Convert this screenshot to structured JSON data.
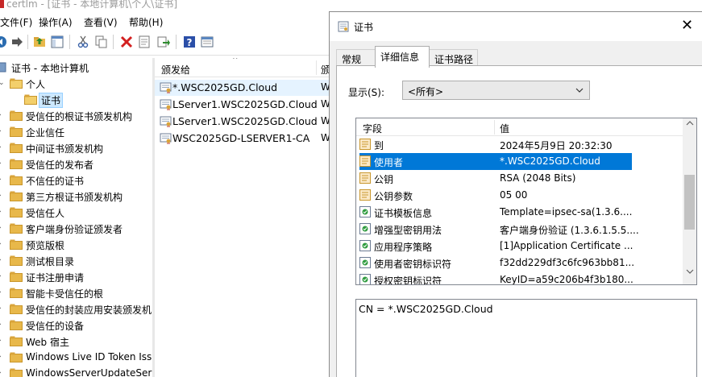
{
  "window": {
    "title": "certlm - [证书 - 本地计算机\\个人\\证书]"
  },
  "menu": [
    "文件(F)",
    "操作(A)",
    "查看(V)",
    "帮助(H)"
  ],
  "toolbar": [
    "back-icon",
    "forward-icon",
    "up-folder-icon",
    "show-hide-tree-icon",
    "cut-icon",
    "copy-icon",
    "delete-icon",
    "properties-icon",
    "export-icon",
    "help-icon",
    "view-icon"
  ],
  "tree": {
    "root": "证书 - 本地计算机",
    "items": [
      {
        "label": "个人",
        "level": 1,
        "expanded": true
      },
      {
        "label": "证书",
        "level": 2,
        "selected": true
      },
      {
        "label": "受信任的根证书颁发机构",
        "level": 1
      },
      {
        "label": "企业信任",
        "level": 1
      },
      {
        "label": "中间证书颁发机构",
        "level": 1
      },
      {
        "label": "受信任的发布者",
        "level": 1
      },
      {
        "label": "不信任的证书",
        "level": 1
      },
      {
        "label": "第三方根证书颁发机构",
        "level": 1
      },
      {
        "label": "受信任人",
        "level": 1
      },
      {
        "label": "客户端身份验证颁发者",
        "level": 1
      },
      {
        "label": "预览版根",
        "level": 1
      },
      {
        "label": "测试根目录",
        "level": 1
      },
      {
        "label": "证书注册申请",
        "level": 1
      },
      {
        "label": "智能卡受信任的根",
        "level": 1
      },
      {
        "label": "受信任的封装应用安装颁发机",
        "level": 1
      },
      {
        "label": "受信任的设备",
        "level": 1
      },
      {
        "label": "Web 宿主",
        "level": 1
      },
      {
        "label": "Windows Live ID Token Iss",
        "level": 1
      },
      {
        "label": "WindowsServerUpdateSer",
        "level": 1
      }
    ]
  },
  "list": {
    "col_issued_to": "颁发给",
    "col_issued_by": "颁",
    "rows": [
      {
        "name": "*.WSC2025GD.Cloud",
        "by": "W",
        "selected": true
      },
      {
        "name": "LServer1.WSC2025GD.Cloud",
        "by": "W"
      },
      {
        "name": "LServer1.WSC2025GD.Cloud",
        "by": "W"
      },
      {
        "name": "WSC2025GD-LSERVER1-CA",
        "by": "W"
      }
    ]
  },
  "dialog": {
    "title": "证书",
    "close": "✕",
    "tabs": [
      "常规",
      "详细信息",
      "证书路径"
    ],
    "active_tab": 1,
    "show_label": "显示(S):",
    "show_value": "<所有>",
    "field_header": "字段",
    "value_header": "值",
    "fields": [
      {
        "name": "到",
        "value": "2024年5月9日 20:32:30"
      },
      {
        "name": "使用者",
        "value": "*.WSC2025GD.Cloud",
        "selected": true
      },
      {
        "name": "公钥",
        "value": "RSA (2048 Bits)"
      },
      {
        "name": "公钥参数",
        "value": "05 00"
      },
      {
        "name": "证书模板信息",
        "value": "Template=ipsec-sa(1.3.6...."
      },
      {
        "name": "增强型密钥用法",
        "value": "客户端身份验证 (1.3.6.1.5.5...."
      },
      {
        "name": "应用程序策略",
        "value": "[1]Application Certificate ..."
      },
      {
        "name": "使用者密钥标识符",
        "value": "f32dd229df3c6fc963bb81..."
      },
      {
        "name": "授权密钥标识符",
        "value": "KeyID=a59c206b4f3b180..."
      }
    ],
    "detail_text": "CN = *.WSC2025GD.Cloud"
  }
}
